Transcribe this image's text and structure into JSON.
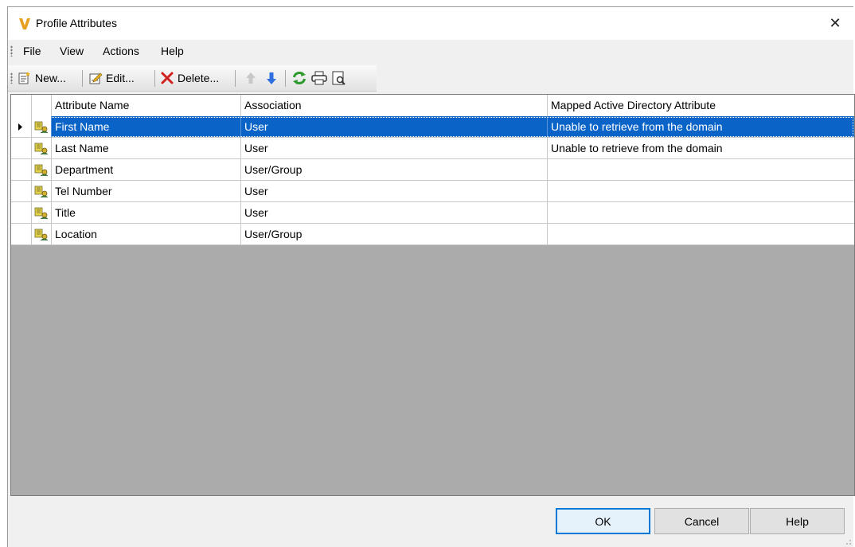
{
  "window": {
    "title": "Profile Attributes",
    "close_glyph": "✕"
  },
  "menu": {
    "items": [
      "File",
      "View",
      "Actions",
      "Help"
    ]
  },
  "toolbar": {
    "new_label": "New...",
    "edit_label": "Edit...",
    "delete_label": "Delete..."
  },
  "table": {
    "columns": [
      "Attribute Name",
      "Association",
      "Mapped Active Directory Attribute"
    ],
    "rows": [
      {
        "name": "First Name",
        "association": "User",
        "mapped": "Unable to retrieve from the domain"
      },
      {
        "name": "Last Name",
        "association": "User",
        "mapped": "Unable to retrieve from the domain"
      },
      {
        "name": "Department",
        "association": "User/Group",
        "mapped": ""
      },
      {
        "name": "Tel Number",
        "association": "User",
        "mapped": ""
      },
      {
        "name": "Title",
        "association": "User",
        "mapped": ""
      },
      {
        "name": "Location",
        "association": "User/Group",
        "mapped": ""
      }
    ]
  },
  "buttons": {
    "ok": "OK",
    "cancel": "Cancel",
    "help": "Help"
  },
  "colors": {
    "selection": "#0a64c8",
    "app_icon": "#e8a020",
    "default_button_border": "#0078d7"
  }
}
